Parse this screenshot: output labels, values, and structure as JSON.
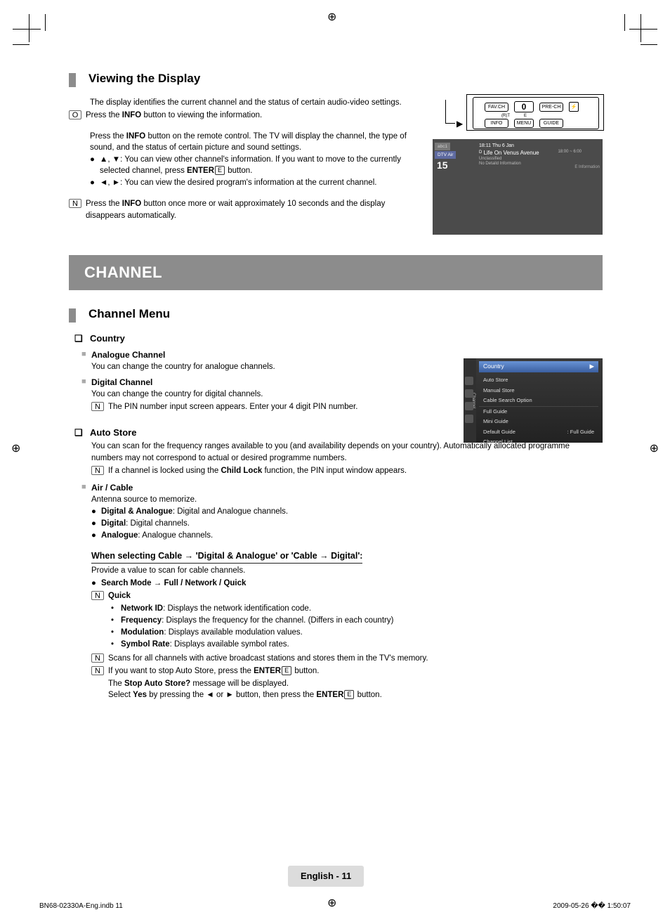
{
  "section1": {
    "title": "Viewing the Display",
    "intro": "The display identifies the current channel and the status of certain audio-video settings.",
    "note_glyph": "O",
    "note1": "Press the INFO button to viewing the information.",
    "p2a": "Press the ",
    "p2b": "INFO",
    "p2c": " button on the remote control. The TV will display the channel, the type of sound, and the status of certain picture and sound settings.",
    "b1a": "▲, ▼: You can view other channel's information. If you want to move to the currently selected channel, press ",
    "b1b": "ENTER",
    "b1c": " button.",
    "b2": "◄, ►: You can view the desired program's information at the current channel.",
    "note2_glyph": "N",
    "note2a": "Press the ",
    "note2b": "INFO",
    "note2c": " button once more or wait approximately 10 seconds and the display disappears automatically."
  },
  "banner": "CHANNEL",
  "section2": {
    "title": "Channel Menu",
    "country": {
      "q": "❑",
      "title": "Country"
    },
    "analogue": {
      "sq": "■",
      "title": "Analogue Channel",
      "text": "You can change the country for analogue channels."
    },
    "digital": {
      "sq": "■",
      "title": "Digital Channel",
      "text": "You can change the country for digital channels.",
      "note_glyph": "N",
      "note": "The PIN number input screen appears. Enter your 4 digit PIN number."
    },
    "autostore": {
      "q": "❑",
      "title": "Auto Store",
      "text": "You can scan for the frequency ranges available to you (and availability depends on your country). Automatically allocated programme numbers may not correspond to actual or desired programme numbers.",
      "note_glyph": "N",
      "note_a": "If a channel is locked using the ",
      "note_b": "Child Lock",
      "note_c": " function, the PIN input window appears."
    },
    "aircable": {
      "sq": "■",
      "title": "Air / Cable",
      "text": "Antenna source to memorize.",
      "b1t": "Digital & Analogue",
      "b1d": ": Digital and Analogue channels.",
      "b2t": "Digital",
      "b2d": ": Digital channels.",
      "b3t": "Analogue",
      "b3d": ": Analogue channels."
    },
    "cable_hdr": "When selecting Cable → 'Digital & Analogue' or 'Cable → Digital':",
    "cable_sub": "Provide a value to scan for cable channels.",
    "search_mode": "Search Mode → Full / Network / Quick",
    "quick_glyph": "N",
    "quick": "Quick",
    "q1t": "Network ID",
    "q1d": ": Displays the network identification code.",
    "q2t": "Frequency",
    "q2d": ": Displays the frequency for the channel. (Differs in each country)",
    "q3t": "Modulation",
    "q3d": ": Displays available modulation values.",
    "q4t": "Symbol Rate",
    "q4d": ": Displays available symbol rates.",
    "scan_glyph": "N",
    "scan": "Scans for all channels with active broadcast stations and stores them in the TV's memory.",
    "stop_glyph": "N",
    "stop_a": "If you want to stop Auto Store, press the ",
    "stop_b": "ENTER",
    "stop_c": " button.",
    "stop2a": "The ",
    "stop2b": "Stop Auto Store?",
    "stop2c": " message will be displayed.",
    "stop3a": "Select ",
    "stop3b": "Yes",
    "stop3c": " by pressing the ◄ or ► button, then press the ",
    "stop3d": "ENTER",
    "stop3e": " button."
  },
  "remote": {
    "favch": "FAV.CH",
    "zero": "0",
    "prech": "PRE-CH",
    "info": "INFO",
    "menu": "MENU",
    "guide": "GUIDE",
    "small1": "(R)T",
    "small2": "E",
    "mute": "⚡"
  },
  "osd": {
    "tag1": "abc1",
    "tag2": "DTV Air",
    "chno": "15",
    "time": "18:11 Thu 6 Jan",
    "dmark": "D",
    "prog": "Life On Venus Avenue",
    "sub": "Unclassified",
    "nod": "No Detaild Information",
    "range": "18:00 ~ 6:00",
    "info": "E Information"
  },
  "menu": {
    "side": "Channel",
    "header": "Country",
    "arrow": "▶",
    "items": [
      {
        "l": "Auto Store",
        "r": ""
      },
      {
        "l": "Manual Store",
        "r": ""
      },
      {
        "l": "Cable Search Option",
        "r": ""
      },
      {
        "l": "Full Guide",
        "r": ""
      },
      {
        "l": "Mini Guide",
        "r": ""
      },
      {
        "l": "Default Guide",
        "r": ": Full Guide"
      },
      {
        "l": "Channel List",
        "r": ""
      }
    ]
  },
  "enter_icon": "E",
  "footer": {
    "pill": "English - 11",
    "left": "BN68-02330A-Eng.indb   11",
    "right": "2009-05-26   �� 1:50:07"
  }
}
